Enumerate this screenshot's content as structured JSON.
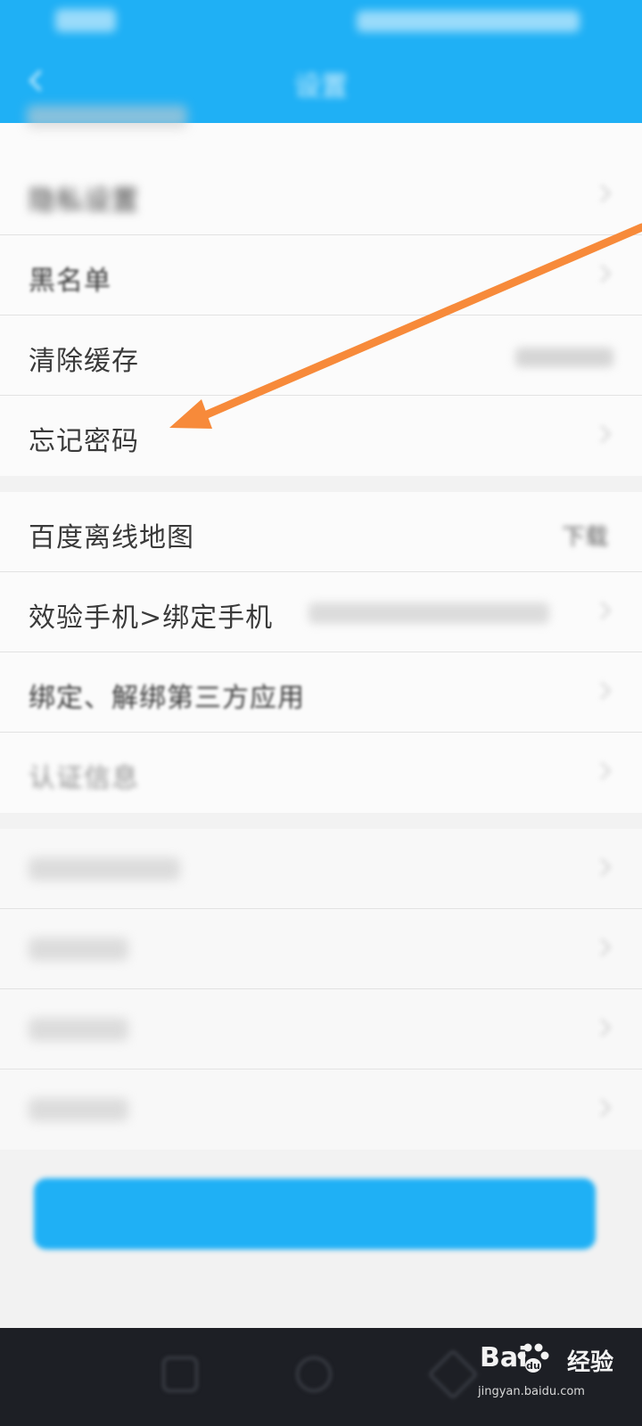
{
  "colors": {
    "accent": "#1fb0f5",
    "arrow": "#f78a3a",
    "navbar": "#1d1f25"
  },
  "header": {
    "title": "设置",
    "status_time": "",
    "status_icons": ""
  },
  "groups": [
    {
      "items": [
        {
          "label": "隐私设置",
          "value": ""
        },
        {
          "label": "黑名单",
          "value": ""
        },
        {
          "label": "清除缓存",
          "value": ""
        },
        {
          "label": "忘记密码",
          "value": ""
        }
      ]
    },
    {
      "items": [
        {
          "label": "百度离线地图",
          "value": "下载"
        },
        {
          "label": "效验手机>绑定手机",
          "value": ""
        },
        {
          "label": "绑定、解绑第三方应用",
          "value": ""
        },
        {
          "label": "认证信息",
          "value": ""
        }
      ]
    }
  ],
  "logout": {
    "label": ""
  },
  "watermark": {
    "brand": "Bai",
    "brand_suffix": "经验",
    "url": "jingyan.baidu.com",
    "paw_icon": "paw-icon"
  }
}
